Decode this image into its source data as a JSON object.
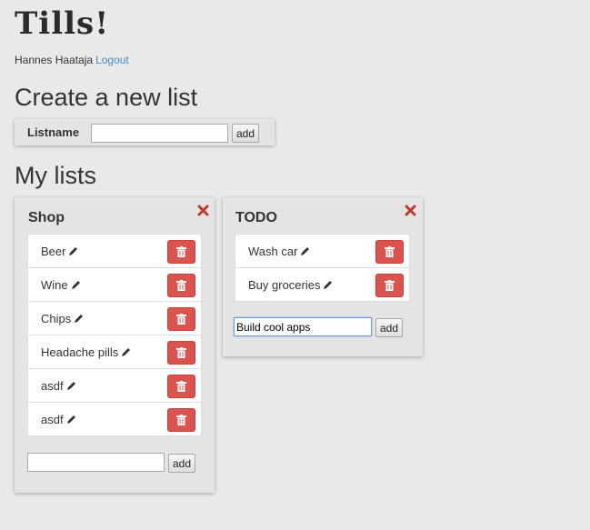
{
  "app": {
    "title": "Tills!"
  },
  "user": {
    "name": "Hannes Haataja",
    "logout_label": "Logout"
  },
  "create_section": {
    "title": "Create a new list",
    "listname_label": "Listname",
    "input_value": "",
    "add_label": "add"
  },
  "lists_section": {
    "title": "My lists"
  },
  "lists": [
    {
      "name": "Shop",
      "items": [
        "Beer",
        "Wine",
        "Chips",
        "Headache pills",
        "asdf",
        "asdf"
      ],
      "new_item_value": "",
      "add_label": "add"
    },
    {
      "name": "TODO",
      "items": [
        "Wash car",
        "Buy groceries"
      ],
      "new_item_value": "Build cool apps",
      "add_label": "add"
    }
  ],
  "icons": {
    "close": "close-icon",
    "edit": "pencil-icon",
    "delete": "trash-icon"
  },
  "colors": {
    "background": "#e9e9e9",
    "danger": "#d9534f",
    "link": "#428bca",
    "close": "#c0392b"
  }
}
